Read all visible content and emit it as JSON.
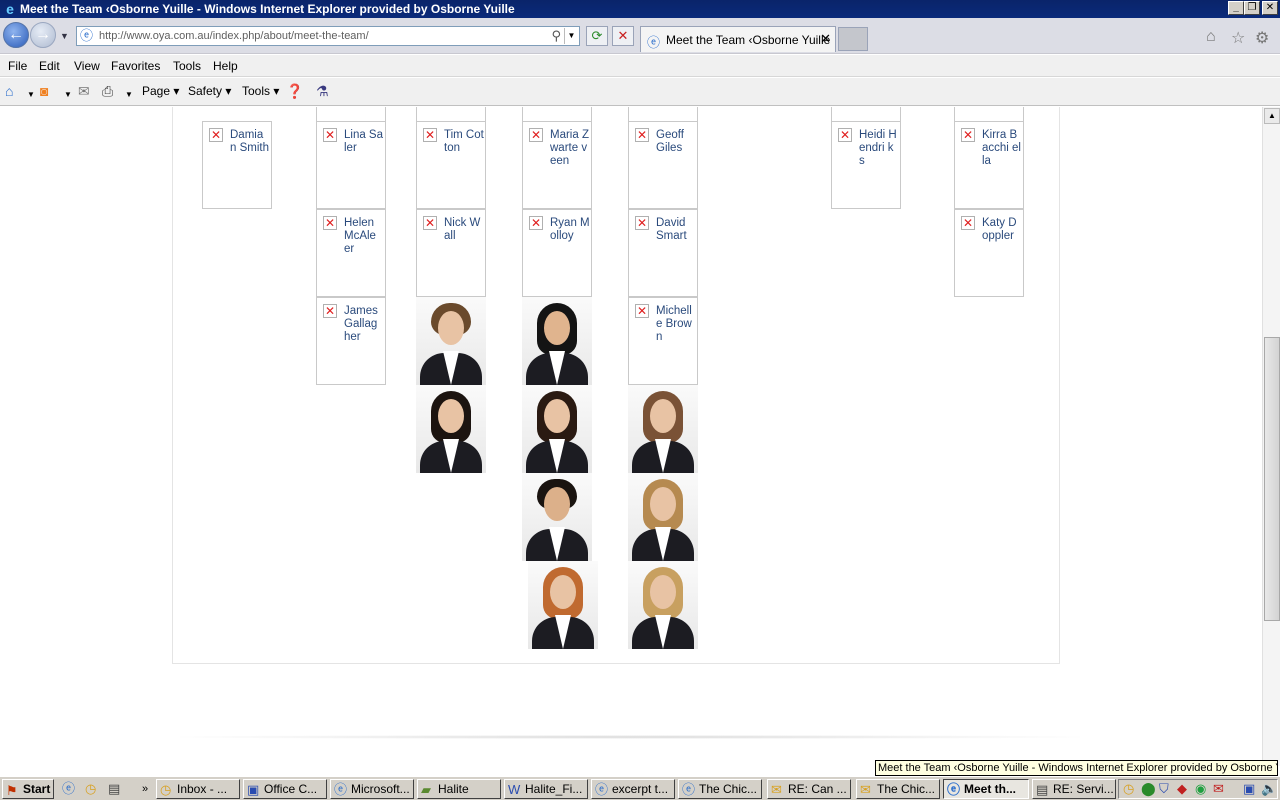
{
  "window": {
    "title": "Meet the Team ‹Osborne Yuille - Windows Internet Explorer provided by Osborne Yuille"
  },
  "address": {
    "url": "http://www.oya.com.au/index.php/about/meet-the-team/"
  },
  "tab": {
    "label": "Meet the Team ‹Osborne Yuille"
  },
  "menu": [
    "File",
    "Edit",
    "View",
    "Favorites",
    "Tools",
    "Help"
  ],
  "commandbar": {
    "page": "Page",
    "safety": "Safety",
    "tools": "Tools"
  },
  "team_cards": {
    "damian": "Damia n Smith",
    "lina": "Lina Saler",
    "tim": "Tim Cotton",
    "maria": "Maria Zwarte veen",
    "geoff": "Geoff Giles",
    "heidi": "Heidi Hendri ks",
    "kirra": "Kirra Bacchi ella",
    "helen": "Helen McAle er",
    "nick": "Nick Wall",
    "ryan": "Ryan Molloy",
    "david": "David Smart",
    "katy": "Katy Doppler",
    "james": "James Gallag her",
    "michelle": "Michell e Brown"
  },
  "tooltip": "Meet the Team ‹Osborne Yuille - Windows Internet Explorer provided by Osborne Y",
  "taskbar": {
    "start": "Start",
    "items": [
      "Inbox - ...",
      "Office C...",
      "Microsoft...",
      "Halite",
      "Halite_Fi...",
      "excerpt t...",
      "The Chic...",
      "RE: Can ...",
      "The Chic...",
      "Meet th...",
      "RE: Servi..."
    ]
  },
  "colors": {
    "link": "#2a4a7c",
    "titlebar": "#0a246a",
    "broken_image_x": "#e02020"
  }
}
